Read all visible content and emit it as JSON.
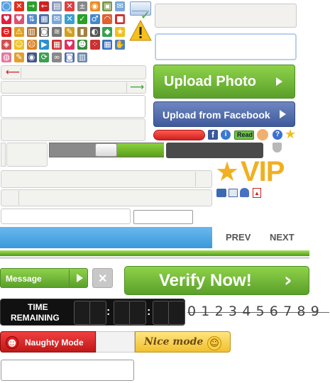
{
  "upload": {
    "photo": "Upload Photo",
    "facebook": "Upload from Facebook"
  },
  "badges": {
    "read": "Read",
    "vip": "VIP"
  },
  "pagination": {
    "prev": "PREV",
    "next": "NEXT"
  },
  "message": {
    "label": "Message",
    "close": "✕"
  },
  "verify": {
    "label": "Verify Now!"
  },
  "timer": {
    "line1": "TIME",
    "line2": "REMAINING",
    "sep1": ":",
    "sep2": ":"
  },
  "digits": [
    "0",
    "1",
    "2",
    "3",
    "4",
    "5",
    "6",
    "7",
    "8",
    "9"
  ],
  "mode": {
    "naughty": "Naughty Mode",
    "nice": "Nice mode"
  },
  "icons": [
    {
      "name": "speech-bubble-icon",
      "color": "#5aa0e0",
      "glyph": "◯"
    },
    {
      "name": "red-x-icon",
      "color": "#e03020",
      "glyph": "✕"
    },
    {
      "name": "green-arrow-right-icon",
      "color": "#2aa02a",
      "glyph": "→"
    },
    {
      "name": "red-arrow-left-icon",
      "color": "#d02020",
      "glyph": "←"
    },
    {
      "name": "document-icon",
      "color": "#8899bb",
      "glyph": "▤"
    },
    {
      "name": "delete-x-icon",
      "color": "#e04040",
      "glyph": "✕"
    },
    {
      "name": "plus-minus-icon",
      "color": "#888888",
      "glyph": "±"
    },
    {
      "name": "rss-icon",
      "color": "#f08a20",
      "glyph": "◉"
    },
    {
      "name": "picture-icon",
      "color": "#7a9a4a",
      "glyph": "▣"
    },
    {
      "name": "envelope-icon",
      "color": "#7aa8d8",
      "glyph": "✉"
    },
    {
      "name": "heart-icon",
      "color": "#e02040",
      "glyph": "♥"
    },
    {
      "name": "heart-outline-icon",
      "color": "#e05070",
      "glyph": "♥"
    },
    {
      "name": "arrows-icon",
      "color": "#5588cc",
      "glyph": "⇅"
    },
    {
      "name": "save-icon",
      "color": "#4a6aa8",
      "glyph": "▦"
    },
    {
      "name": "mail-icon",
      "color": "#7aa8d8",
      "glyph": "✉"
    },
    {
      "name": "remove-icon",
      "color": "#3aa0d0",
      "glyph": "✕"
    },
    {
      "name": "checkmark-icon",
      "color": "#2aa02a",
      "glyph": "✓"
    },
    {
      "name": "gender-icon",
      "color": "#4488cc",
      "glyph": "♂"
    },
    {
      "name": "rainbow-icon",
      "color": "#e06030",
      "glyph": "◠"
    },
    {
      "name": "gift-icon",
      "color": "#d03030",
      "glyph": "■"
    },
    {
      "name": "stop-icon",
      "color": "#e02020",
      "glyph": "⊖"
    },
    {
      "name": "warning-icon",
      "color": "#e0a020",
      "glyph": "⚠"
    },
    {
      "name": "book-icon",
      "color": "#b07030",
      "glyph": "▥"
    },
    {
      "name": "camera-icon",
      "color": "#666666",
      "glyph": "◙"
    },
    {
      "name": "wifi-icon",
      "color": "#777777",
      "glyph": "≋"
    },
    {
      "name": "star-pen-icon",
      "color": "#d0a020",
      "glyph": "✎"
    },
    {
      "name": "lock-icon",
      "color": "#a08040",
      "glyph": "▮"
    },
    {
      "name": "toggle-icon",
      "color": "#555555",
      "glyph": "◐"
    },
    {
      "name": "tag-icon",
      "color": "#3aa050",
      "glyph": "◆"
    },
    {
      "name": "star-icon",
      "color": "#f0c020",
      "glyph": "★"
    },
    {
      "name": "cube-icon",
      "color": "#d05050",
      "glyph": "◈"
    },
    {
      "name": "smile-icon",
      "color": "#f0c020",
      "glyph": "☺"
    },
    {
      "name": "sad-icon",
      "color": "#e08020",
      "glyph": "☹"
    },
    {
      "name": "play-icon",
      "color": "#2a90d0",
      "glyph": "▶"
    },
    {
      "name": "calendar-icon",
      "color": "#cc3333",
      "glyph": "▦"
    },
    {
      "name": "heart-small-icon",
      "color": "#e03060",
      "glyph": "♥"
    },
    {
      "name": "people-icon",
      "color": "#3a8a3a",
      "glyph": "☻"
    },
    {
      "name": "dots-icon",
      "color": "#cc3030",
      "glyph": "⁘"
    },
    {
      "name": "grid-icon",
      "color": "#3a70c0",
      "glyph": "▦"
    },
    {
      "name": "thumb-icon",
      "color": "#4a80c0",
      "glyph": "✋"
    },
    {
      "name": "cake-icon",
      "color": "#e07aa0",
      "glyph": "◍"
    },
    {
      "name": "edit-pencil-icon",
      "color": "#e0a030",
      "glyph": "✎"
    },
    {
      "name": "eye-icon",
      "color": "#445588",
      "glyph": "◉"
    },
    {
      "name": "refresh-icon",
      "color": "#3aa050",
      "glyph": "⟳"
    },
    {
      "name": "link-icon",
      "color": "#888888",
      "glyph": "∞"
    },
    {
      "name": "photo-icon",
      "color": "#4a6aa8",
      "glyph": "◙"
    },
    {
      "name": "basket-icon",
      "color": "#6a88aa",
      "glyph": "▥"
    }
  ]
}
